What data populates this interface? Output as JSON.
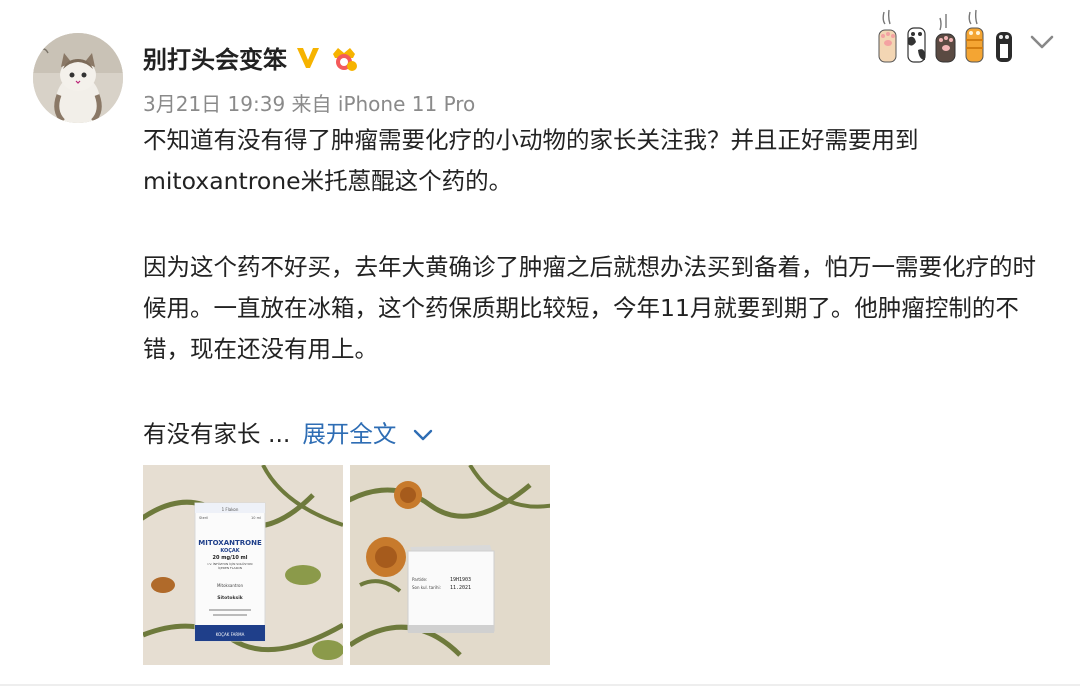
{
  "post": {
    "username": "别打头会变笨",
    "date": "3月21日 19:39",
    "source_prefix": "来自",
    "source": "iPhone 11 Pro",
    "paragraphs": [
      "不知道有没有得了肿瘤需要化疗的小动物的家长关注我？并且正好需要用到mitoxantrone米托蒽醌这个药的。",
      "因为这个药不好买，去年大黄确诊了肿瘤之后就想办法买到备着，怕万一需要化疗的时候用。一直放在冰箱，这个药保质期比较短，今年11月就要到期了。他肿瘤控制的不错，现在还没有用上。"
    ],
    "truncated_text": "有没有家长 ...",
    "expand_label": "展开全文"
  },
  "photo1": {
    "box_small_top": "1 Flakon",
    "box_left": "Steril",
    "box_right": "10 ml",
    "brand": "MITOXANTRONE",
    "maker": "KOÇAK",
    "dose": "20 mg/10 ml",
    "sub1": "I.V. İNFÜZYON İÇİN SOLÜSYON",
    "sub2": "İÇEREN FLAKON",
    "ingredient": "Mitoksantron",
    "cytotoxic": "Sitotoksik",
    "footer": "KOÇAK FARMA"
  },
  "photo2": {
    "lot_label": "Partide:",
    "lot_value": "19H1903",
    "exp_label": "Son kul. tarihi:",
    "exp_value": "11.2021"
  },
  "colors": {
    "link": "#2e6db4",
    "meta": "#8a8a8a",
    "badge": "#f6b300"
  },
  "icons": [
    "verified-v-icon",
    "crown-badge-icon",
    "paw-icons",
    "chevron-down-icon"
  ]
}
